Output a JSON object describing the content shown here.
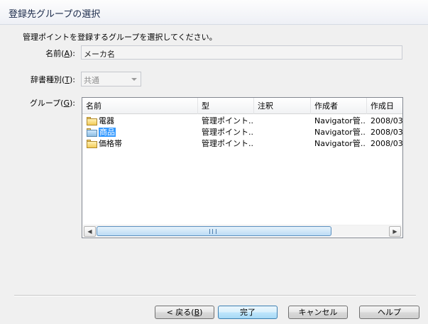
{
  "window": {
    "title": "登録先グループの選択"
  },
  "instruction": "管理ポイントを登録するグループを選択してください。",
  "name_field": {
    "label": "名前",
    "accel": "A",
    "value": "メーカ名"
  },
  "dict_type": {
    "label": "辞書種別",
    "accel": "T",
    "value": "共通"
  },
  "group_list": {
    "label": "グループ",
    "accel": "G",
    "columns": [
      "名前",
      "型",
      "注釈",
      "作成者",
      "作成日"
    ],
    "rows": [
      {
        "name": "電器",
        "type": "管理ポイント...",
        "note": "",
        "author": "Navigator管...",
        "date": "2008/03."
      },
      {
        "name": "商品",
        "type": "管理ポイント...",
        "note": "",
        "author": "Navigator管...",
        "date": "2008/03."
      },
      {
        "name": "価格帯",
        "type": "管理ポイント...",
        "note": "",
        "author": "Navigator管...",
        "date": "2008/03."
      }
    ],
    "selected_index": 1
  },
  "buttons": {
    "back": {
      "label": "< 戻る(",
      "accel": "B",
      "tail": ")"
    },
    "finish": "完了",
    "cancel": "キャンセル",
    "help": "ヘルプ"
  },
  "colors": {
    "selection": "#3399ff",
    "header_bg": "#fbfbfd"
  }
}
